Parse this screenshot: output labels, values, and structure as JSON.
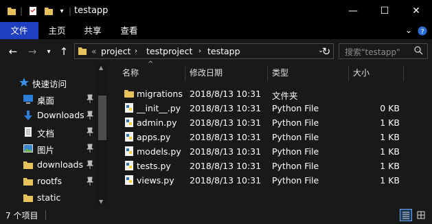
{
  "window": {
    "title": "testapp",
    "controls": {
      "minimize": "—",
      "maximize": "☐",
      "close": "✕"
    }
  },
  "ribbon": {
    "tabs": [
      {
        "label": "文件",
        "active": true
      },
      {
        "label": "主页",
        "active": false
      },
      {
        "label": "共享",
        "active": false
      },
      {
        "label": "查看",
        "active": false
      }
    ],
    "expand_icon": "chevron-down-icon",
    "help_icon": "help-icon"
  },
  "navigation": {
    "breadcrumbs": [
      "project",
      "testproject",
      "testapp"
    ],
    "overflow": "«",
    "search_placeholder": "搜索\"testapp\""
  },
  "sidebar": {
    "items": [
      {
        "label": "快速访问",
        "icon": "star-icon",
        "pinned": false,
        "indent": false
      },
      {
        "label": "桌面",
        "icon": "desktop-icon",
        "pinned": true,
        "indent": true
      },
      {
        "label": "Downloads",
        "icon": "download-arrow-icon",
        "pinned": true,
        "indent": true
      },
      {
        "label": "文档",
        "icon": "document-icon",
        "pinned": true,
        "indent": true
      },
      {
        "label": "图片",
        "icon": "picture-icon",
        "pinned": true,
        "indent": true
      },
      {
        "label": "downloads",
        "icon": "folder-icon",
        "pinned": true,
        "indent": true
      },
      {
        "label": "rootfs",
        "icon": "folder-icon",
        "pinned": true,
        "indent": true
      },
      {
        "label": "static",
        "icon": "folder-icon",
        "pinned": false,
        "indent": true
      }
    ]
  },
  "file_list": {
    "columns": {
      "name": "名称",
      "date": "修改日期",
      "type": "类型",
      "size": "大小"
    },
    "rows": [
      {
        "name": "migrations",
        "date": "2018/8/13 10:31",
        "type": "文件夹",
        "size": "",
        "icon": "folder-icon"
      },
      {
        "name": "__init__.py",
        "date": "2018/8/13 10:31",
        "type": "Python File",
        "size": "0 KB",
        "icon": "python-file-icon"
      },
      {
        "name": "admin.py",
        "date": "2018/8/13 10:31",
        "type": "Python File",
        "size": "1 KB",
        "icon": "python-file-icon"
      },
      {
        "name": "apps.py",
        "date": "2018/8/13 10:31",
        "type": "Python File",
        "size": "1 KB",
        "icon": "python-file-icon"
      },
      {
        "name": "models.py",
        "date": "2018/8/13 10:31",
        "type": "Python File",
        "size": "1 KB",
        "icon": "python-file-icon"
      },
      {
        "name": "tests.py",
        "date": "2018/8/13 10:31",
        "type": "Python File",
        "size": "1 KB",
        "icon": "python-file-icon"
      },
      {
        "name": "views.py",
        "date": "2018/8/13 10:31",
        "type": "Python File",
        "size": "1 KB",
        "icon": "python-file-icon"
      }
    ]
  },
  "status": {
    "item_count": "7 个项目"
  },
  "colors": {
    "accent": "#1e3fc0",
    "folder": "#e9c15a",
    "background": "#191919"
  }
}
